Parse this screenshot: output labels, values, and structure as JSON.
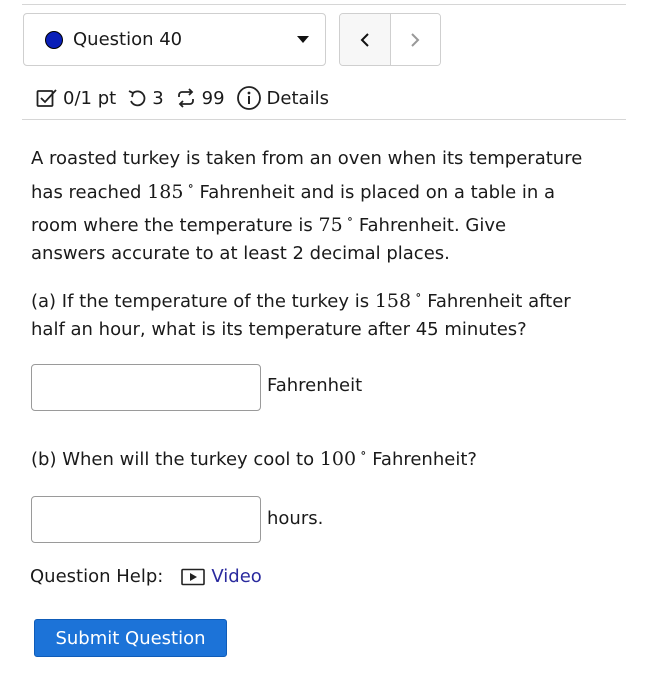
{
  "header": {
    "question_select": "Question 40",
    "prev_glyph": "‹",
    "next_glyph": "›"
  },
  "meta": {
    "score": "0/1 pt",
    "attempts": "3",
    "versions": "99",
    "details": "Details"
  },
  "problem": {
    "p1": [
      "A roasted turkey is taken from an oven when its temperature",
      "has reached ",
      "185",
      " Fahrenheit and is placed on a table in a",
      "room where the temperature is ",
      "75",
      " Fahrenheit. Give",
      "answers accurate to at least 2 decimal places."
    ],
    "part_a": [
      "(a) If the temperature of the turkey is ",
      "158",
      " Fahrenheit after",
      "half an hour, what is its temperature after 45 minutes?"
    ],
    "part_a_unit": "Fahrenheit",
    "part_a_value": "",
    "part_b": [
      "(b) When will the turkey cool to ",
      "100",
      " Fahrenheit?"
    ],
    "part_b_unit": "hours.",
    "part_b_value": "",
    "degree_symbol": "∘"
  },
  "help": {
    "label": "Question Help:",
    "video": "Video"
  },
  "submit_label": "Submit Question",
  "colors": {
    "status_dot": "#0a1fb8",
    "submit_bg": "#1c73d8",
    "link": "#2a2a9e"
  }
}
